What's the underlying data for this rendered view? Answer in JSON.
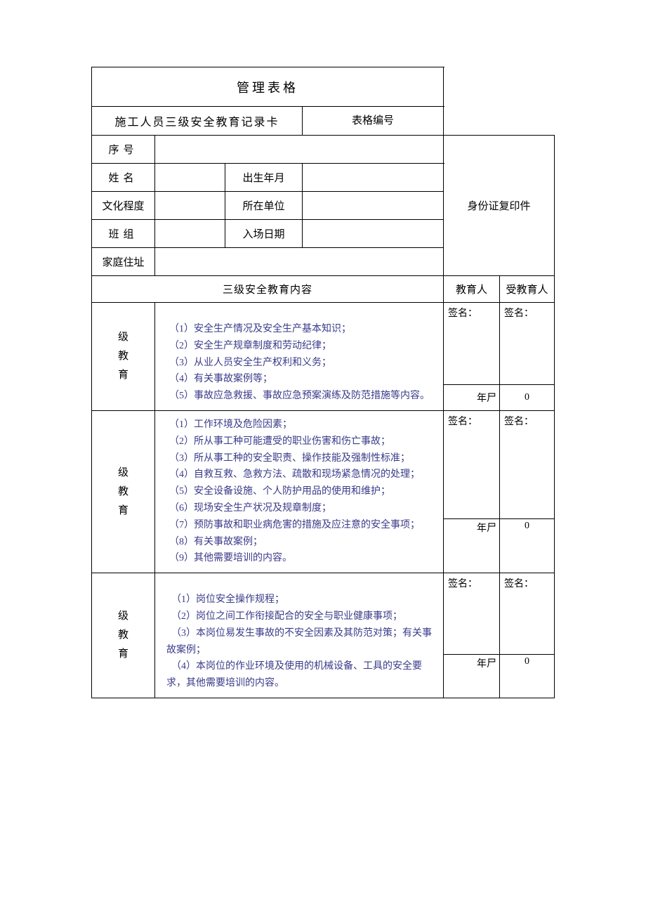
{
  "header": {
    "title": "管理表格",
    "subtitle": "施工人员三级安全教育记录卡",
    "form_number_label": "表格编号"
  },
  "info": {
    "seq_label": "序号",
    "name_label": "姓名",
    "dob_label": "出生年月",
    "edu_label": "文化程度",
    "unit_label": "所在单位",
    "team_label": "班组",
    "entry_label": "入场日期",
    "address_label": "家庭住址",
    "id_copy_label": "身份证复印件"
  },
  "section": {
    "content_header": "三级安全教育内容",
    "educator_label": "教育人",
    "trainee_label": "受教育人",
    "sign_label": "签名：",
    "date_marker_year": "年尸",
    "zero": "0"
  },
  "level_label": "级教育",
  "level_a": {
    "items": [
      "（1）安全生产情况及安全生产基本知识；",
      "（2）安全生产规章制度和劳动纪律；",
      "（3）从业人员安全生产权利和义务；",
      "（4）有关事故案例等；",
      "（5）事故应急救援、事故应急预案演练及防范措施等内容。"
    ]
  },
  "level_b": {
    "items": [
      "（1）工作环境及危险因素；",
      "（2）所从事工种可能遭受的职业伤害和伤亡事故；",
      "（3）所从事工种的安全职责、操作技能及强制性标准；",
      "（4）自救互救、急救方法、疏散和现场紧急情况的处理；",
      "（5）安全设备设施、个人防护用品的使用和维护；",
      "（6）现场安全生产状况及规章制度；",
      "（7）预防事故和职业病危害的措施及应注意的安全事项；",
      "（8）有关事故案例；",
      "（9）其他需要培训的内容。"
    ]
  },
  "level_c": {
    "items": [
      "　（1）岗位安全操作规程；",
      "　（2）岗位之间工作衔接配合的安全与职业健康事项；",
      "　（3）本岗位易发生事故的不安全因素及其防范对策；有关事故案例；",
      "　（4）本岗位的作业环境及使用的机械设备、工具的安全要求，其他需要培训的内容。"
    ]
  }
}
